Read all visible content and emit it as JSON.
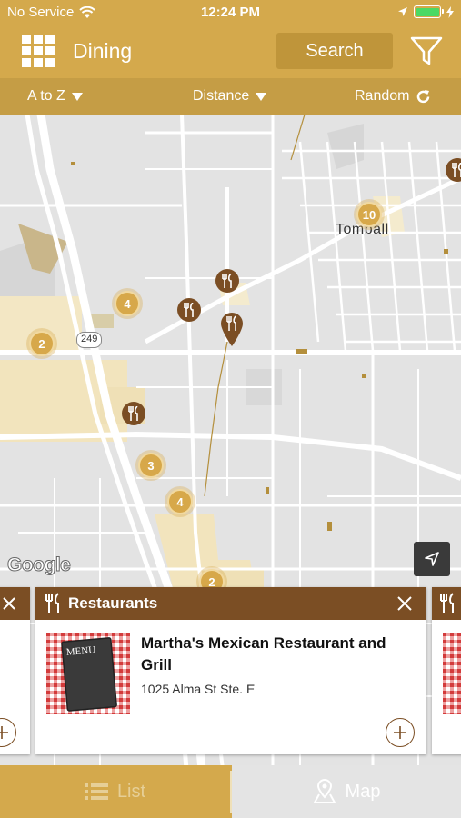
{
  "status_bar": {
    "carrier": "No Service",
    "time": "12:24 PM"
  },
  "header": {
    "title": "Dining",
    "search_label": "Search"
  },
  "sort_bar": {
    "az": "A to Z",
    "distance": "Distance",
    "random": "Random"
  },
  "map": {
    "town_label": "Tomball",
    "highway_label": "249",
    "google_label": "Google",
    "clusters": [
      "10",
      "4",
      "2",
      "3",
      "4",
      "2"
    ]
  },
  "card": {
    "category": "Restaurants",
    "name": "Martha's Mexican Restaurant and Grill",
    "address": "1025 Alma St Ste. E",
    "menu_text": "MENU"
  },
  "tabs": {
    "list": "List",
    "map": "Map"
  },
  "colors": {
    "gold": "#d4a94c",
    "brown": "#7b4e24",
    "dark_gold": "#bf953a"
  }
}
